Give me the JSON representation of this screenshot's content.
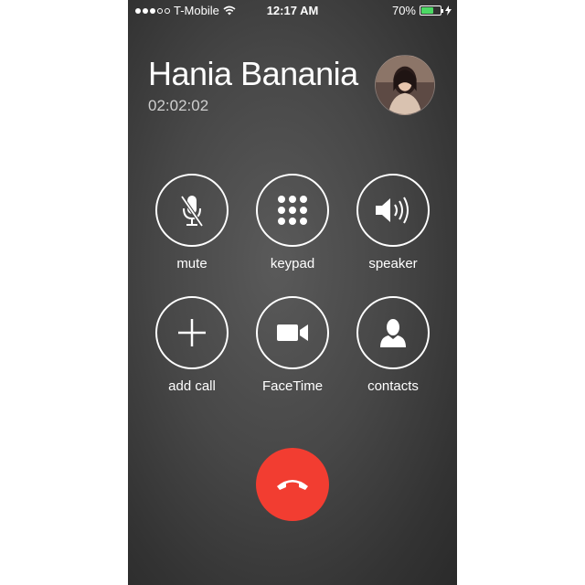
{
  "status_bar": {
    "carrier": "T-Mobile",
    "time": "12:17 AM",
    "battery_percent": "70%",
    "battery_level": 0.7,
    "signal_bars_filled": 3,
    "signal_bars_total": 5
  },
  "call": {
    "caller_name": "Hania Banania",
    "duration": "02:02:02"
  },
  "buttons": [
    {
      "label": "mute",
      "icon": "muted-microphone-icon"
    },
    {
      "label": "keypad",
      "icon": "keypad-grid-icon"
    },
    {
      "label": "speaker",
      "icon": "speaker-icon"
    },
    {
      "label": "add call",
      "icon": "plus-icon"
    },
    {
      "label": "FaceTime",
      "icon": "video-camera-icon"
    },
    {
      "label": "contacts",
      "icon": "person-icon"
    }
  ],
  "end_call": {
    "icon": "hang-up-phone-icon",
    "color": "#f23d31"
  },
  "colors": {
    "battery": "#4cd964",
    "end_call": "#f23d31"
  }
}
